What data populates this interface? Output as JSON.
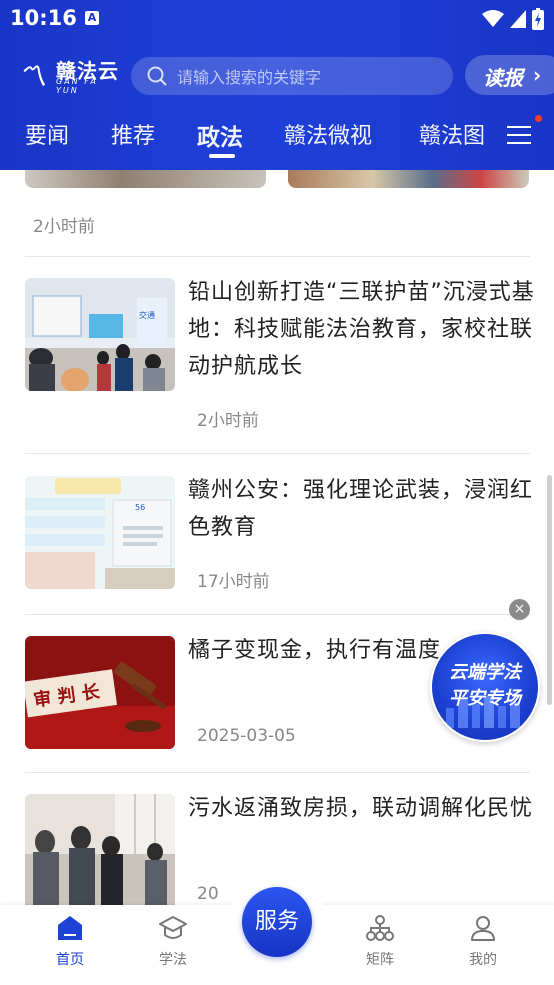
{
  "status_bar": {
    "time": "10:16",
    "notification_icon": "A"
  },
  "header": {
    "logo_name": "赣法云",
    "logo_sub": "GAN FA YUN",
    "search_placeholder": "请输入搜索的关键字",
    "read_button": "读报"
  },
  "tabs": [
    {
      "label": "要闻"
    },
    {
      "label": "推荐"
    },
    {
      "label": "政法",
      "active": true
    },
    {
      "label": "赣法微视"
    },
    {
      "label": "赣法图"
    }
  ],
  "feed": {
    "prev_time": "2小时前",
    "items": [
      {
        "title": "铅山创新打造“三联护苗”沉浸式基地：科技赋能法治教育，家校社联动护航成长",
        "time": "2小时前"
      },
      {
        "title": "赣州公安：强化理论武装，浸润红色教育",
        "time": "17小时前"
      },
      {
        "title": "橘子变现金，执行有温度",
        "time": "2025-03-05"
      },
      {
        "title": "污水返涌致房损，联动调解化民忧",
        "time": "20"
      }
    ]
  },
  "floating_badge": {
    "line1": "云端学法",
    "line2": "平安专场",
    "close": "×"
  },
  "bottom_nav": {
    "items": [
      {
        "label": "首页",
        "icon": "home-icon",
        "active": true
      },
      {
        "label": "学法",
        "icon": "graduation-cap-icon"
      },
      {
        "label": "矩阵",
        "icon": "org-chart-icon"
      },
      {
        "label": "我的",
        "icon": "user-icon"
      }
    ],
    "center": "服务"
  },
  "colors": {
    "brand_blue": "#1f40d8",
    "active_nav": "#1d42d6",
    "badge_red": "#ff3b30"
  }
}
